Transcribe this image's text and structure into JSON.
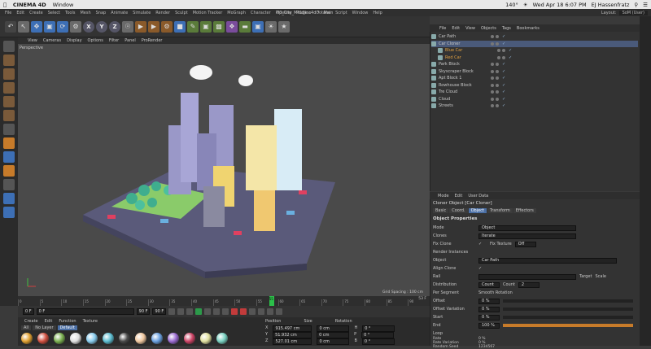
{
  "mac": {
    "app": "CINEMA 4D",
    "menus": [
      "Window"
    ],
    "battery": "140°",
    "datetime": "Wed Apr 18 6:07 PM",
    "user": "EJ Hassenfratz"
  },
  "app_menu": {
    "items": [
      "File",
      "Edit",
      "Create",
      "Select",
      "Tools",
      "Mesh",
      "Snap",
      "Animate",
      "Simulate",
      "Render",
      "Sculpt",
      "Motion Tracker",
      "MoGraph",
      "Character",
      "Pipeline",
      "Plugins",
      "Octane",
      "Script",
      "Window",
      "Help"
    ],
    "window_title": "00_City_Middle.c4d * - Main",
    "layout_label": "Layout:",
    "layout_value": "SoM (User)"
  },
  "toolbar": {
    "axes": [
      "X",
      "Y",
      "Z"
    ]
  },
  "viewport": {
    "menu": [
      "View",
      "Cameras",
      "Display",
      "Options",
      "Filter",
      "Panel",
      "ProRender"
    ],
    "label": "Perspective",
    "grid_spacing": "Grid Spacing : 100 cm"
  },
  "timeline": {
    "ticks": [
      "0",
      "5",
      "10",
      "15",
      "20",
      "25",
      "30",
      "35",
      "40",
      "45",
      "50",
      "55",
      "60",
      "65",
      "70",
      "75",
      "80",
      "85",
      "90"
    ],
    "current_frame_marker": "55",
    "end_label": "53 F",
    "playhead_fraction": 0.61
  },
  "transport": {
    "start": "0 F",
    "current": "0 F",
    "end": "90 F",
    "fps": "90 F"
  },
  "materials": {
    "menu": [
      "Create",
      "Edit",
      "Function",
      "Texture"
    ],
    "tabs": [
      "All",
      "No Layer",
      "Default"
    ],
    "ball_colors": [
      "#e0a030",
      "#d05040",
      "#7bb050",
      "#e0e0e0",
      "#88ccee",
      "#5bbcd0",
      "#4a4a4a",
      "#f0c8a0",
      "#6aa0e0",
      "#9a6ad0",
      "#cc4466",
      "#e0e0a0",
      "#78d0c0"
    ]
  },
  "coordinates": {
    "headers": [
      "Position",
      "Size",
      "Rotation"
    ],
    "rows": [
      {
        "axis": "X",
        "pos": "915.497 cm",
        "size": "0 cm",
        "rot_label": "H",
        "rot": "0 °"
      },
      {
        "axis": "Y",
        "pos": "51.932 cm",
        "size": "0 cm",
        "rot_label": "P",
        "rot": "0 °"
      },
      {
        "axis": "Z",
        "pos": "527.01 cm",
        "size": "0 cm",
        "rot_label": "B",
        "rot": "0 °"
      }
    ]
  },
  "object_manager": {
    "menu": [
      "File",
      "Edit",
      "View",
      "Objects",
      "Tags",
      "Bookmarks"
    ],
    "objects": [
      {
        "name": "Car Path",
        "selected": false
      },
      {
        "name": "Car Cloner",
        "selected": true
      },
      {
        "name": "Blue Car",
        "selected": false
      },
      {
        "name": "Red Car",
        "selected": false
      },
      {
        "name": "Park Block",
        "selected": false
      },
      {
        "name": "Skyscraper Block",
        "selected": false
      },
      {
        "name": "Apt Block 1",
        "selected": false
      },
      {
        "name": "Rowhouse Block",
        "selected": false
      },
      {
        "name": "Tre Cloud",
        "selected": false
      },
      {
        "name": "Cloud",
        "selected": false
      },
      {
        "name": "Streets",
        "selected": false
      }
    ]
  },
  "attributes": {
    "menu": [
      "Mode",
      "Edit",
      "User Data"
    ],
    "title": "Cloner Object [Car Cloner]",
    "tabs": [
      "Basic",
      "Coord.",
      "Object",
      "Transform",
      "Effectors"
    ],
    "active_tab": "Object",
    "section": "Object Properties",
    "mode_label": "Mode",
    "mode_value": "Object",
    "clones_label": "Clones",
    "clones_value": "Iterate",
    "fix_clone": "Fix Clone",
    "fix_texture_label": "Fix Texture",
    "fix_texture_value": "Off",
    "render_instances": "Render Instances",
    "object_label": "Object",
    "object_value": "Car Path",
    "align_clone": "Align Clone",
    "rail_label": "Rail",
    "target_label": "Target",
    "scale_label": "Scale",
    "distribution_label": "Distribution",
    "distribution_value": "Count",
    "count_label": "Count",
    "count_value": "2",
    "per_segment": "Per Segment",
    "smooth_rotation": "Smooth Rotation",
    "sliders": [
      {
        "label": "Offset",
        "value": "0 %",
        "fraction": 0.0
      },
      {
        "label": "Offset Variation",
        "value": "0 %",
        "fraction": 0.0
      },
      {
        "label": "Start",
        "value": "0 %",
        "fraction": 0.0
      },
      {
        "label": "End",
        "value": "100 %",
        "fraction": 1.0
      }
    ],
    "loop": "Loop",
    "extra": [
      {
        "label": "Rate",
        "value": "0 %"
      },
      {
        "label": "Rate Variation",
        "value": "0 %"
      },
      {
        "label": "Random Seed",
        "value": "1234567"
      }
    ]
  }
}
